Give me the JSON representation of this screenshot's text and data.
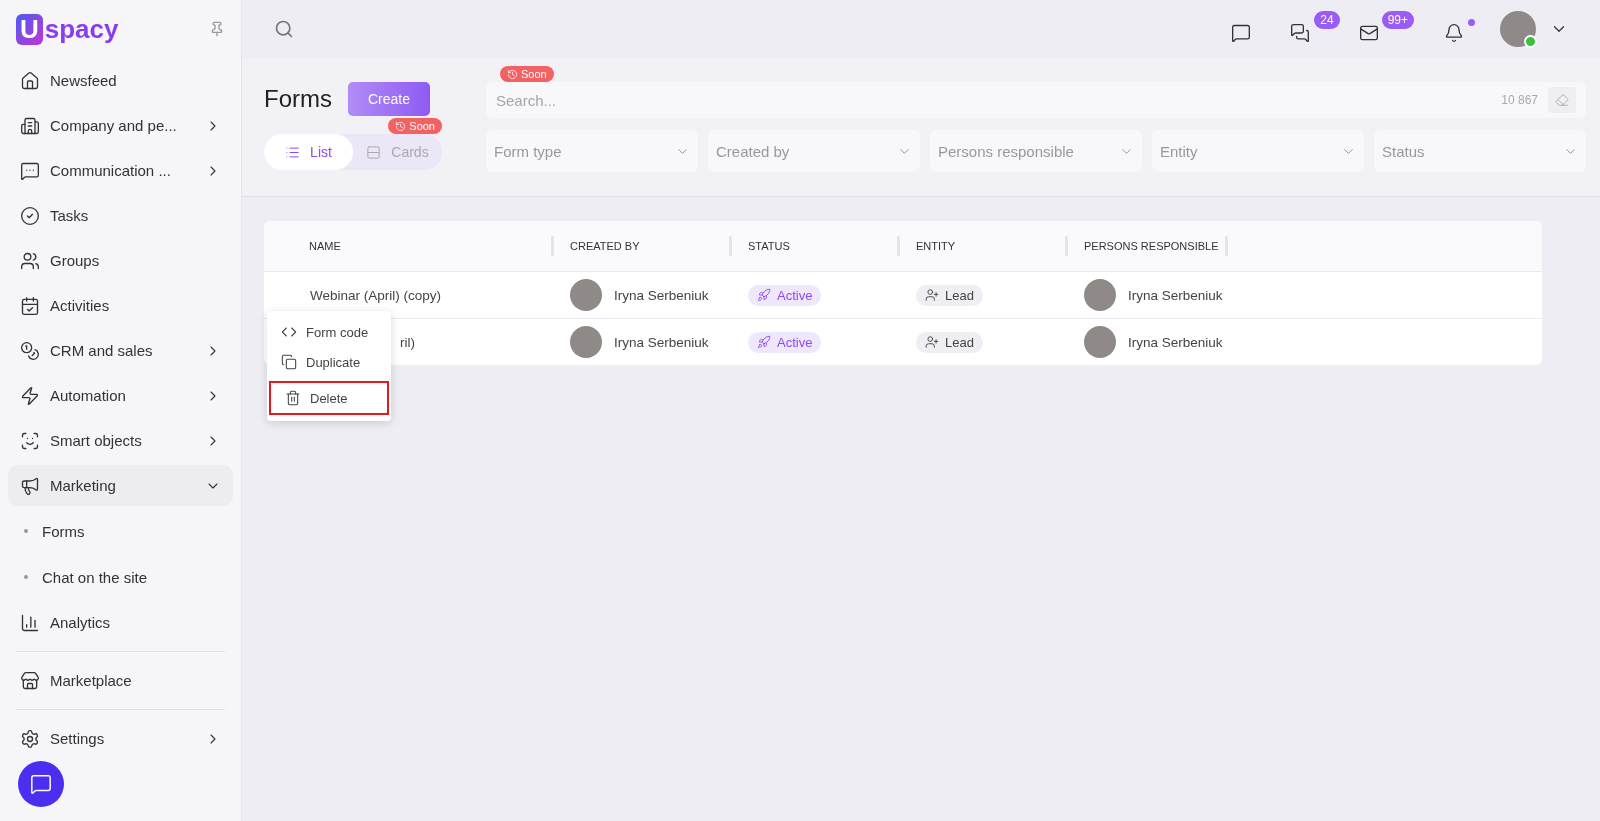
{
  "logo": {
    "mark": "U",
    "text": "spacy"
  },
  "sidebar": {
    "sections": [
      [
        {
          "label": "Newsfeed"
        },
        {
          "label": "Company and pe...",
          "expanded": false
        },
        {
          "label": "Communication ...",
          "expanded": false
        },
        {
          "label": "Tasks"
        },
        {
          "label": "Groups"
        },
        {
          "label": "Activities"
        },
        {
          "label": "CRM and sales",
          "expanded": false
        },
        {
          "label": "Automation",
          "expanded": false
        },
        {
          "label": "Smart objects",
          "expanded": false
        },
        {
          "label": "Marketing",
          "expanded": true,
          "children": [
            {
              "label": "Forms"
            },
            {
              "label": "Chat on the site"
            }
          ]
        },
        {
          "label": "Analytics"
        }
      ],
      [
        {
          "label": "Marketplace"
        }
      ],
      [
        {
          "label": "Settings",
          "expanded": false
        }
      ]
    ]
  },
  "topbar": {
    "badges": [
      {
        "dot": false
      },
      {
        "count": "24",
        "dot": false
      },
      {
        "count": "99+",
        "dot": false
      },
      {
        "dot": true
      }
    ],
    "user_online": true
  },
  "page": {
    "title": "Forms",
    "create": "Create",
    "views": [
      {
        "label": "List",
        "selected": true
      },
      {
        "label": "Cards",
        "selected": false,
        "soon": "Soon"
      }
    ],
    "search": {
      "placeholder": "Search...",
      "soon": "Soon",
      "count": "10 867"
    },
    "filters": [
      "Form type",
      "Created by",
      "Persons responsible",
      "Entity",
      "Status"
    ]
  },
  "table": {
    "columns": [
      "NAME",
      "CREATED BY",
      "STATUS",
      "ENTITY",
      "PERSONS RESPONSIBLE"
    ],
    "rows": [
      {
        "name": "Webinar (April) (copy)",
        "created_by": "Iryna Serbeniuk",
        "status": "Active",
        "entity": "Lead",
        "responsible": "Iryna Serbeniuk"
      },
      {
        "name": "ril)",
        "created_by": "Iryna Serbeniuk",
        "status": "Active",
        "entity": "Lead",
        "responsible": "Iryna Serbeniuk",
        "menu": [
          {
            "label": "Form code",
            "highlighted": false
          },
          {
            "label": "Duplicate",
            "highlighted": false
          },
          {
            "label": "Delete",
            "highlighted": true
          }
        ]
      }
    ]
  }
}
